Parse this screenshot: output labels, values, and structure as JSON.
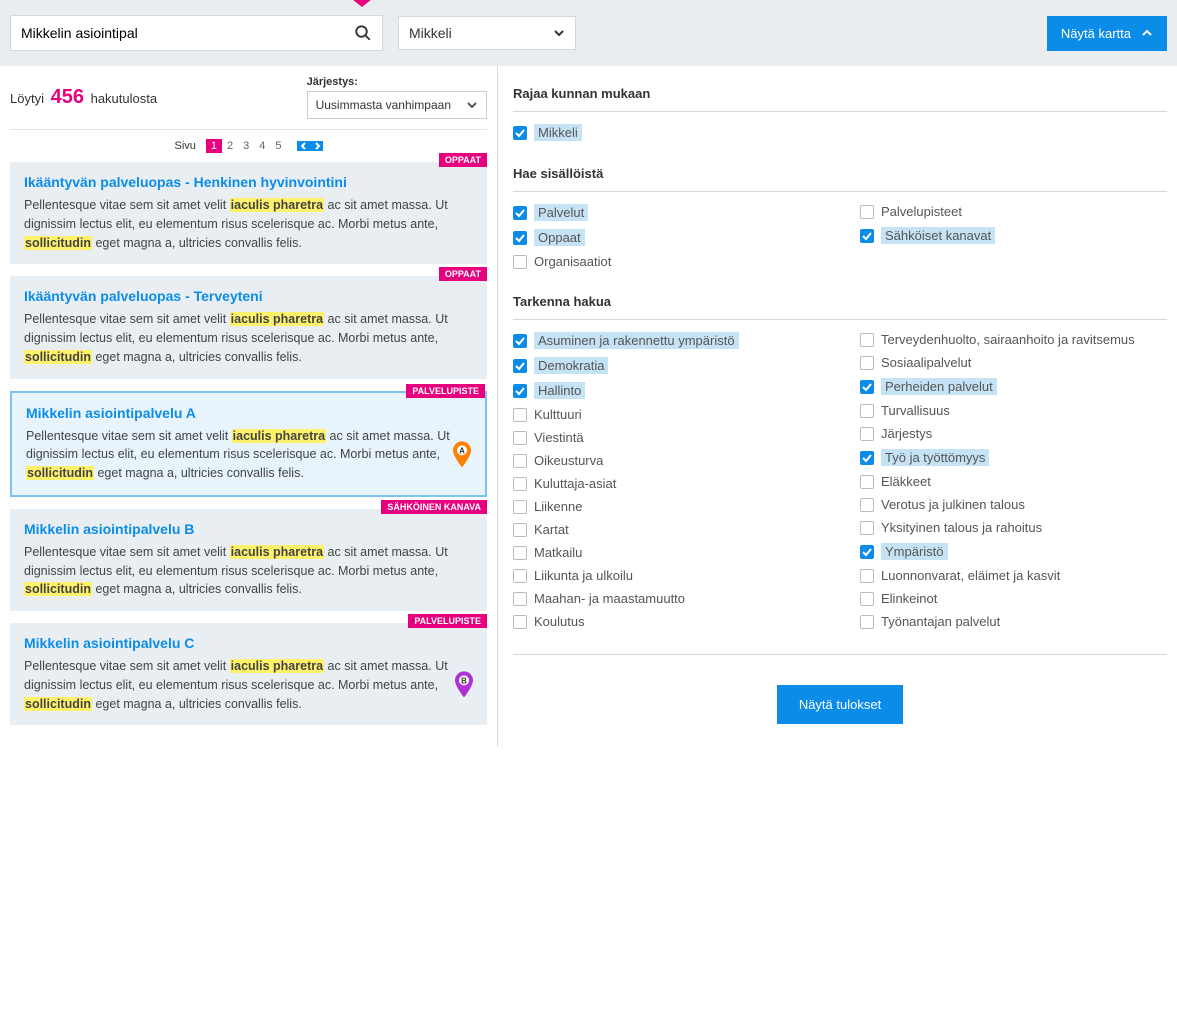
{
  "topbar": {
    "search_value": "Mikkelin asiointipal",
    "muni_selected": "Mikkeli",
    "map_button": "Näytä kartta"
  },
  "results": {
    "prefix": "Löytyi",
    "count": "456",
    "suffix": "hakutulosta",
    "sort_label": "Järjestys:",
    "sort_value": "Uusimmasta vanhimpaan",
    "page_label": "Sivu",
    "pages": [
      "1",
      "2",
      "3",
      "4",
      "5"
    ],
    "body_pre": "Pellentesque vitae sem sit amet velit ",
    "hl1": "iaculis pharetra",
    "body_mid": " ac sit amet massa. Ut dignissim lectus elit, eu elementum risus scelerisque ac. Morbi metus ante, ",
    "hl2": "sollicitudin",
    "body_post": " eget magna a, ultricies convallis felis.",
    "items": [
      {
        "title": "Ikääntyvän palveluopas - Henkinen hyvinvointini",
        "badge": "OPPAAT",
        "badge_class": "badge-oppaat"
      },
      {
        "title": "Ikääntyvän palveluopas - Terveyteni",
        "badge": "OPPAAT",
        "badge_class": "badge-oppaat"
      },
      {
        "title": "Mikkelin asiointipalvelu A",
        "badge": "PALVELUPISTE",
        "badge_class": "badge-palvelupiste",
        "selected": true,
        "pin": "A",
        "pin_color": "#ff7f00"
      },
      {
        "title": "Mikkelin asiointipalvelu B",
        "badge": "SÄHKÖINEN KANAVA",
        "badge_class": "badge-sahkoinen"
      },
      {
        "title": "Mikkelin asiointipalvelu C",
        "badge": "PALVELUPISTE",
        "badge_class": "badge-palvelupiste",
        "pin": "B",
        "pin_color": "#b030d8"
      }
    ]
  },
  "filters": {
    "muni_title": "Rajaa kunnan mukaan",
    "muni_items": [
      {
        "label": "Mikkeli",
        "checked": true
      }
    ],
    "content_title": "Hae sisällöistä",
    "content_left": [
      {
        "label": "Palvelut",
        "checked": true
      },
      {
        "label": "Oppaat",
        "checked": true
      },
      {
        "label": "Organisaatiot",
        "checked": false
      }
    ],
    "content_right": [
      {
        "label": "Palvelupisteet",
        "checked": false
      },
      {
        "label": "Sähköiset kanavat",
        "checked": true
      }
    ],
    "refine_title": "Tarkenna hakua",
    "refine_left": [
      {
        "label": "Asuminen ja rakennettu ympäristö",
        "checked": true
      },
      {
        "label": "Demokratia",
        "checked": true
      },
      {
        "label": "Hallinto",
        "checked": true
      },
      {
        "label": "Kulttuuri",
        "checked": false
      },
      {
        "label": "Viestintä",
        "checked": false
      },
      {
        "label": "Oikeusturva",
        "checked": false
      },
      {
        "label": "Kuluttaja-asiat",
        "checked": false
      },
      {
        "label": "Liikenne",
        "checked": false
      },
      {
        "label": "Kartat",
        "checked": false
      },
      {
        "label": "Matkailu",
        "checked": false
      },
      {
        "label": "Liikunta ja ulkoilu",
        "checked": false
      },
      {
        "label": "Maahan- ja maastamuutto",
        "checked": false
      },
      {
        "label": "Koulutus",
        "checked": false
      }
    ],
    "refine_right": [
      {
        "label": "Terveydenhuolto, sairaanhoito ja ravitsemus",
        "checked": false
      },
      {
        "label": "Sosiaalipalvelut",
        "checked": false
      },
      {
        "label": "Perheiden palvelut",
        "checked": true
      },
      {
        "label": "Turvallisuus",
        "checked": false
      },
      {
        "label": "Järjestys",
        "checked": false
      },
      {
        "label": "Työ ja työttömyys",
        "checked": true
      },
      {
        "label": "Eläkkeet",
        "checked": false
      },
      {
        "label": "Verotus ja julkinen talous",
        "checked": false
      },
      {
        "label": "Yksityinen talous ja rahoitus",
        "checked": false
      },
      {
        "label": "Ympäristö",
        "checked": true
      },
      {
        "label": "Luonnonvarat, eläimet ja kasvit",
        "checked": false
      },
      {
        "label": "Elinkeinot",
        "checked": false
      },
      {
        "label": "Työnantajan palvelut",
        "checked": false
      }
    ],
    "show_results": "Näytä tulokset"
  }
}
